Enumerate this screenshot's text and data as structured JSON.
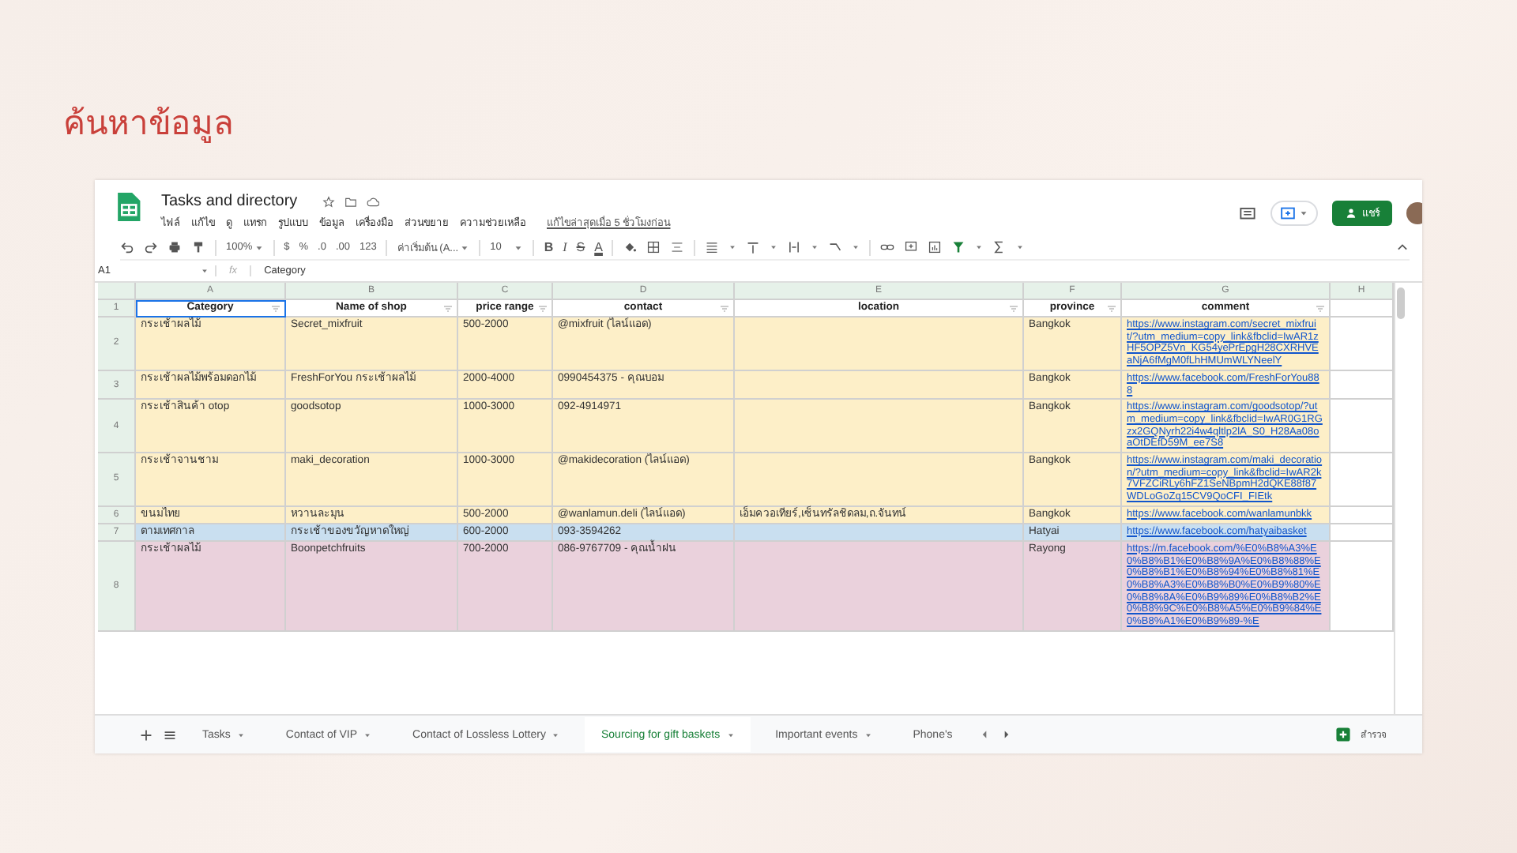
{
  "slide": {
    "title": "ค้นหาข้อมูล"
  },
  "app": {
    "doc_title": "Tasks and directory",
    "menu": [
      "ไฟล์",
      "แก้ไข",
      "ดู",
      "แทรก",
      "รูปแบบ",
      "ข้อมูล",
      "เครื่องมือ",
      "ส่วนขยาย",
      "ความช่วยเหลือ"
    ],
    "last_edit": "แก้ไขล่าสุดเมื่อ 5 ชั่วโมงก่อน",
    "share_label": "แชร์"
  },
  "toolbar": {
    "zoom": "100%",
    "number_formats": [
      "$",
      "%",
      ".0",
      ".00",
      "123"
    ],
    "font": "ค่าเริ่มต้น (A...",
    "font_size": "10",
    "text_styles": [
      "B",
      "I",
      "S",
      "A"
    ]
  },
  "formula_bar": {
    "cell_ref": "A1",
    "fx": "fx",
    "content": "Category"
  },
  "column_letters": [
    "A",
    "B",
    "C",
    "D",
    "E",
    "F",
    "G",
    "H"
  ],
  "header": {
    "number": "1",
    "cells": [
      {
        "label": "Category",
        "selected": true
      },
      {
        "label": "Name of shop",
        "selected": false
      },
      {
        "label": "price range",
        "selected": false
      },
      {
        "label": "contact",
        "selected": false
      },
      {
        "label": "location",
        "selected": false
      },
      {
        "label": "province",
        "selected": false
      },
      {
        "label": "comment",
        "selected": false
      }
    ]
  },
  "rows": [
    {
      "number": "2",
      "color": "#fdefc8",
      "category": "กระเช้าผลไม้",
      "shop": "Secret_mixfruit",
      "price": "500-2000",
      "contact": "@mixfruit (ไลน์แอด)",
      "province": "Bangkok",
      "comment": "https://www.instagram.com/secret_mixfruit/?utm_medium=copy_link&fbclid=IwAR1zHF5OPZ5Vn_KG54yePrEpgH28CXRHVEaNjA6fMgM0fLhHMUmWLYNeelY"
    },
    {
      "number": "3",
      "color": "#fdefc8",
      "category": "กระเช้าผลไม้พร้อมดอกไม้",
      "shop": "FreshForYou กระเช้าผลไม้",
      "price": "2000-4000",
      "contact": "0990454375 - คุณบอม",
      "province": "Bangkok",
      "comment": "https://www.facebook.com/FreshForYou888"
    },
    {
      "number": "4",
      "color": "#fdefc8",
      "category": "กระเช้าสินค้า otop",
      "shop": "goodsotop",
      "price": "1000-3000",
      "contact": "092-4914971",
      "province": "Bangkok",
      "comment": "https://www.instagram.com/goodsotop/?utm_medium=copy_link&fbclid=IwAR0G1RGzx2GQNyrh22i4w4qltlp2lA_S0_H28Aa08oaOtDEfD59M_ee7S8"
    },
    {
      "number": "5",
      "color": "#fdefc8",
      "category": "กระเช้าจานชาม",
      "shop": "maki_decoration",
      "price": "1000-3000",
      "contact": "@makidecoration (ไลน์แอด)",
      "province": "Bangkok",
      "comment": "https://www.instagram.com/maki_decoration/?utm_medium=copy_link&fbclid=IwAR2k7VFZCiRLy6hFZ1SeNBpmH2dQKE88f87WDLoGoZq15CV9QoCFI_FIEtk"
    },
    {
      "number": "6",
      "color": "#fdefc8",
      "category": "ขนมไทย",
      "shop": "หวานละมุน",
      "price": "500-2000",
      "contact": "@wanlamun.deli (ไลน์แอด)",
      "location": "เอ็มควอเทียร์,เซ็นทรัลชิดลม,ถ.จันทน์",
      "province": "Bangkok",
      "comment": "https://www.facebook.com/wanlamunbkk"
    },
    {
      "number": "7",
      "color": "#c9dff0",
      "category": "ตามเทศกาล",
      "shop": "กระเช้าของขวัญหาดใหญ่",
      "price": "600-2000",
      "contact": "093-3594262",
      "province": "Hatyai",
      "comment": "https://www.facebook.com/hatyaibasket"
    },
    {
      "number": "8",
      "color": "#ead1dc",
      "category": "กระเช้าผลไม้",
      "shop": "Boonpetchfruits",
      "price": "700-2000",
      "contact": "086-9767709 - คุณน้ำฝน",
      "province": "Rayong",
      "comment": "https://m.facebook.com/%E0%B8%A3%E0%B8%B1%E0%B8%9A%E0%B8%88%E0%B8%B1%E0%B8%94%E0%B8%81%E0%B8%A3%E0%B8%B0%E0%B9%80%E0%B8%8A%E0%B9%89%E0%B8%B2%E0%B8%9C%E0%B8%A5%E0%B9%84%E0%B8%A1%E0%B9%89-%E"
    }
  ],
  "sheet_tabs": [
    {
      "label": "Tasks",
      "selected": false
    },
    {
      "label": "Contact of VIP",
      "selected": false
    },
    {
      "label": "Contact of Lossless Lottery",
      "selected": false
    },
    {
      "label": "Sourcing for gift baskets",
      "selected": true
    },
    {
      "label": "Important events",
      "selected": false
    },
    {
      "label": "Phone's",
      "selected": false
    }
  ],
  "explore_label": "สำรวจ"
}
